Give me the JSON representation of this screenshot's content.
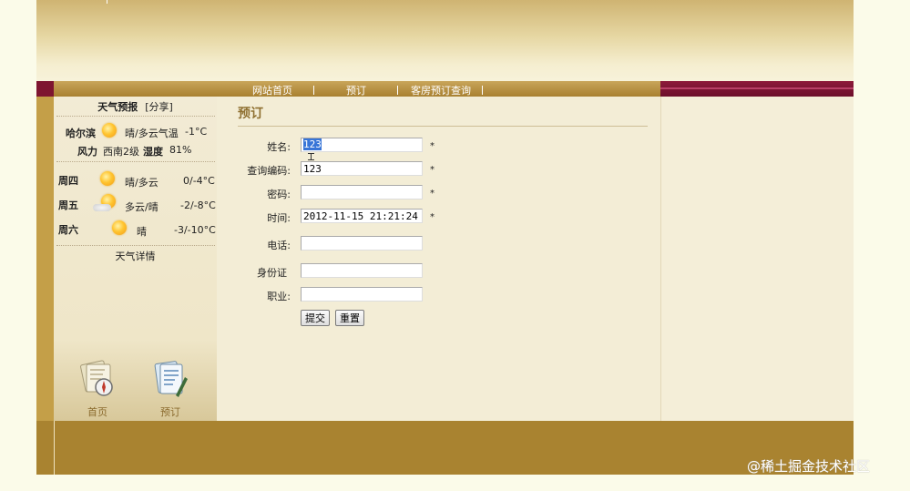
{
  "nav": {
    "items": [
      "网站首页",
      "预订",
      "客房预订查询"
    ]
  },
  "weather": {
    "title": "天气预报",
    "share": "[分享]",
    "city": "哈尔滨",
    "today_condition": "晴/多云气温",
    "today_temp": "-1°C",
    "wind_label": "风力",
    "wind_value": "西南2级",
    "humidity_label": "湿度",
    "humidity_value": "81%",
    "forecast": [
      {
        "day": "周四",
        "condition": "晴/多云",
        "temp": "0/-4°C",
        "icon": "sun-icon"
      },
      {
        "day": "周五",
        "condition": "多云/晴",
        "temp": "-2/-8°C",
        "icon": "cloud-sun-icon"
      },
      {
        "day": "周六",
        "condition": "晴",
        "temp": "-3/-10°C",
        "icon": "sun-icon"
      }
    ],
    "details_link": "天气详情"
  },
  "quick_links": [
    {
      "label": "首页",
      "icon": "compass-map-icon"
    },
    {
      "label": "预订",
      "icon": "document-pen-icon"
    }
  ],
  "form": {
    "title": "预订",
    "fields": {
      "name": {
        "label": "姓名:",
        "value": "123",
        "required": "*"
      },
      "code": {
        "label": "查询编码:",
        "value": "123",
        "required": "*"
      },
      "password": {
        "label": "密码:",
        "value": "",
        "required": "*"
      },
      "time": {
        "label": "时间:",
        "value": "2012-11-15 21:21:24",
        "required": "*"
      },
      "phone": {
        "label": "电话:",
        "value": ""
      },
      "id_card": {
        "label": "身份证",
        "value": ""
      },
      "job": {
        "label": "职业:",
        "value": ""
      }
    },
    "submit_label": "提交",
    "reset_label": "重置"
  },
  "watermark": "@稀土掘金技术社区",
  "colors": {
    "accent_brown": "#a98330",
    "maroon": "#7e1530",
    "title_gold": "#8f7031"
  }
}
